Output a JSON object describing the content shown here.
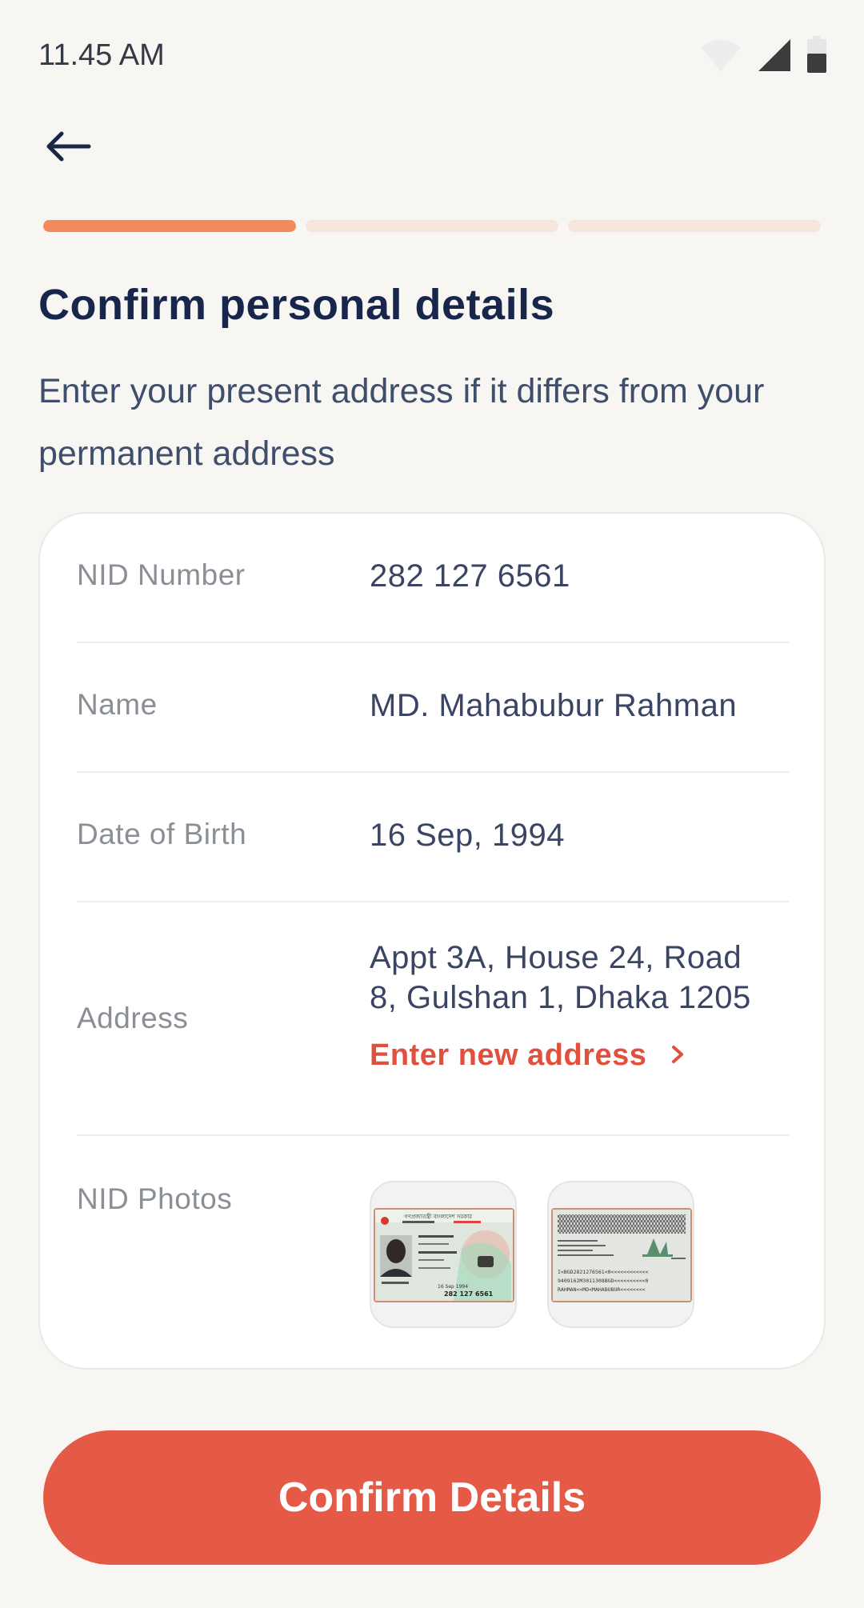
{
  "status_bar": {
    "time": "11.45 AM",
    "icons": [
      "wifi-icon",
      "signal-icon",
      "battery-icon"
    ]
  },
  "header": {
    "back_icon": "arrow-left-icon"
  },
  "progress": {
    "total_steps": 3,
    "current_step": 1,
    "active_color": "#f28a5c",
    "inactive_color": "#f6e6dd"
  },
  "page": {
    "title": "Confirm personal details",
    "subtitle": "Enter your present address if it differs from your permanent address"
  },
  "details": {
    "nid_number_label": "NID Number",
    "nid_number_value": "282 127 6561",
    "name_label": "Name",
    "name_value": "MD. Mahabubur Rahman",
    "dob_label": "Date of Birth",
    "dob_value": "16 Sep, 1994",
    "address_label": "Address",
    "address_line1": "Appt 3A, House 24, Road",
    "address_line2": "8, Gulshan 1, Dhaka  1205",
    "enter_new_address": "Enter new address",
    "nid_photos_label": "NID Photos"
  },
  "nid_card_front": {
    "header": "গণপ্রজাতন্ত্রী বাংলাদেশ সরকার",
    "id_number": "282 127 6561",
    "birth": "16 Sep 1994"
  },
  "nid_card_back": {
    "mrz_line1": "I<BGD2821276561<0<<<<<<<<<<<<",
    "mrz_line2": "9409162M3011308BGD<<<<<<<<<<0",
    "mrz_line3": "RAHMAN<<MD<MAHABUBUR<<<<<<<<"
  },
  "actions": {
    "confirm_label": "Confirm Details"
  },
  "colors": {
    "accent": "#e55a47",
    "title": "#17264a",
    "background": "#f7f6f3"
  }
}
